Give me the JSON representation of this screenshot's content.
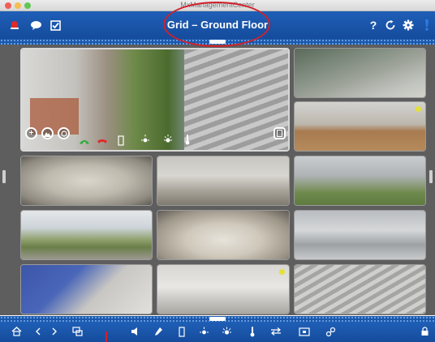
{
  "window": {
    "title": "MxManagementCenter"
  },
  "header": {
    "title": "Grid – Ground Floor",
    "left_icons": [
      "alarm-bell-icon",
      "chat-icon",
      "checkbox-icon"
    ],
    "right_icons": [
      "help-icon",
      "refresh-icon",
      "settings-icon",
      "alert-icon"
    ],
    "help_glyph": "?"
  },
  "grid": {
    "cameras": [
      {
        "name": "camera-lobby-main",
        "scene": "lobby with staircase and tree",
        "selected": true
      },
      {
        "name": "camera-parking-lot-top",
        "scene": "parking lot"
      },
      {
        "name": "camera-office-floor",
        "scene": "office with wooden floor",
        "status_dot": true
      },
      {
        "name": "camera-corridor-fisheye",
        "scene": "fisheye office corridor"
      },
      {
        "name": "camera-atrium",
        "scene": "atrium interior"
      },
      {
        "name": "camera-facade",
        "scene": "building facade"
      },
      {
        "name": "camera-outdoor-panorama",
        "scene": "outdoor panorama"
      },
      {
        "name": "camera-lecture-hall",
        "scene": "lecture hall with people"
      },
      {
        "name": "camera-parking-entrance",
        "scene": "parking entrance with cars"
      },
      {
        "name": "camera-lounge",
        "scene": "blue lounge"
      },
      {
        "name": "camera-hallway",
        "scene": "hallway",
        "status_dot": true
      },
      {
        "name": "camera-stairs",
        "scene": "exterior stairs"
      }
    ]
  },
  "overlay": {
    "zoom_in": "+",
    "icons": [
      "zoom-in-icon",
      "image-adjust-icon",
      "target-icon",
      "phone-accept-icon",
      "phone-hangup-icon",
      "door-icon",
      "light-low-icon",
      "light-high-icon",
      "thermometer-icon",
      "fullscreen-icon"
    ]
  },
  "bottombar": {
    "icons": [
      "home-icon",
      "back-icon",
      "forward-icon",
      "layout-icon",
      "speaker-icon",
      "microphone-icon",
      "door-icon",
      "light-low-icon",
      "light-high-icon",
      "thermometer-icon",
      "swap-icon",
      "screen-icon",
      "link-icon",
      "lock-icon"
    ]
  },
  "colors": {
    "toolbar_blue": "#1a58ad",
    "highlight_red": "#d3202a",
    "status_yellow": "#e3e03a",
    "grid_bg": "#5e5e5e"
  }
}
